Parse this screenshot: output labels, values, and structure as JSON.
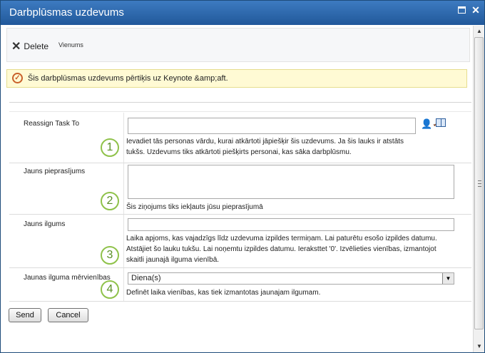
{
  "window": {
    "title": "Darbplūsmas uzdevums",
    "maximize_icon": "maximize-icon",
    "close_icon": "close-icon",
    "close_glyph": "✕"
  },
  "ribbon": {
    "delete_label": "Delete",
    "group_label": "Vienums"
  },
  "info": {
    "text": "Šis darbplūsmas uzdevums pērtiķis uz Keynote &amp;aft."
  },
  "form": {
    "rows": [
      {
        "label": "Reassign Task To",
        "callout": "1",
        "desc1": "Ievadiet tās personas vārdu, kurai atkārtoti jāpiešķir šis uzdevums. Ja šis lauks ir atstāts",
        "desc2": "tukšs. Uzdevums tiks atkārtoti piešķirts personai, kas sāka darbplūsmu."
      },
      {
        "label": "Jauns pieprasījums",
        "callout": "2",
        "desc1": "Šis ziņojums tiks iekļauts jūsu pieprasījumā"
      },
      {
        "label": "Jauns ilgums",
        "callout": "3",
        "desc1": "Laika apjoms, kas vajadzīgs līdz uzdevuma izpildes termiņam. Lai paturētu esošo izpildes datumu.",
        "desc2": "Atstājiet šo lauku tukšu. Lai noņemtu izpildes datumu. Ieraksttet '0'. Izvēlieties vienības, izmantojot",
        "desc3": "skaitli jaunajā ilguma vienībā."
      },
      {
        "label": "Jaunas ilguma mērvienības",
        "callout": "4",
        "select_value": "Diena(s)",
        "desc1": "Definēt laika vienības, kas tiek izmantotas jaunajam ilgumam."
      }
    ]
  },
  "buttons": {
    "send": "Send",
    "cancel": "Cancel"
  },
  "colors": {
    "titlebar": "#2d6aaf",
    "callout_ring": "#8fc24a",
    "info_bg": "#fffad4"
  }
}
